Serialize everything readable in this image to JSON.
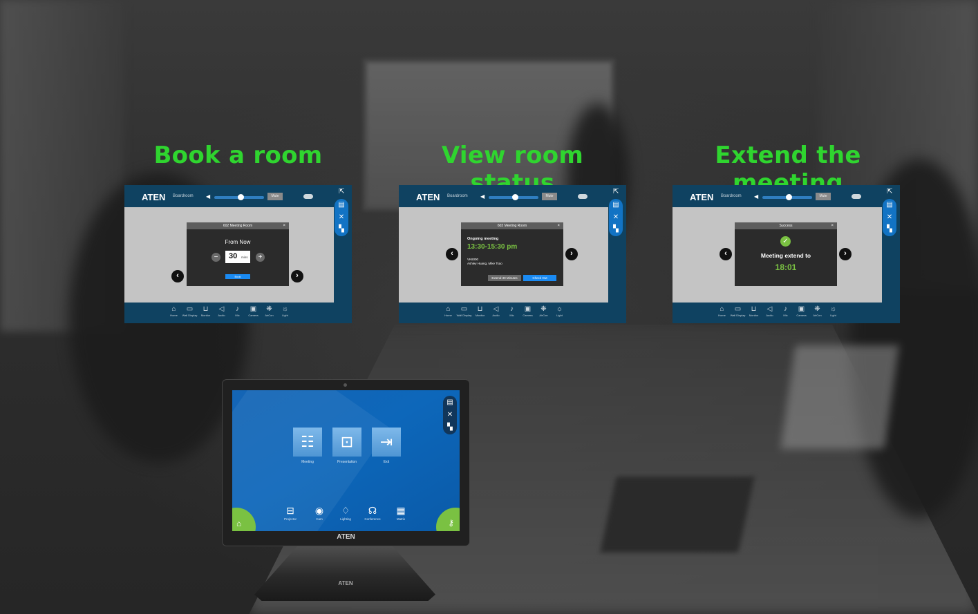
{
  "headings": {
    "book": "Book a room",
    "status": "View room status",
    "extend": "Extend the meeting"
  },
  "colors": {
    "heading": "#2fd52f",
    "panel_navy": "#0f4261",
    "accent_blue": "#1273c4",
    "accent_green": "#7ac142",
    "time_green": "#7ac142"
  },
  "panel_common": {
    "logo": "ATEN",
    "room": "Boardroom",
    "mute": "Mute",
    "nav": [
      {
        "icon": "home-icon",
        "glyph": "⌂",
        "label": "Home"
      },
      {
        "icon": "wall-display-icon",
        "glyph": "▭",
        "label": "Wall Display"
      },
      {
        "icon": "monitor-icon",
        "glyph": "⊔",
        "label": "Monitor"
      },
      {
        "icon": "audio-icon",
        "glyph": "◁",
        "label": "Audio"
      },
      {
        "icon": "mic-icon",
        "glyph": "♪",
        "label": "Mic"
      },
      {
        "icon": "camera-icon",
        "glyph": "▣",
        "label": "Camera"
      },
      {
        "icon": "aircon-icon",
        "glyph": "❋",
        "label": "AirCon"
      },
      {
        "icon": "light-icon",
        "glyph": "☼",
        "label": "Light"
      }
    ]
  },
  "book_dialog": {
    "title": "602 Meeting Room",
    "close": "×",
    "from": "From Now",
    "value": "30",
    "unit": "mins",
    "minus": "−",
    "plus": "+",
    "button": "Book"
  },
  "status_dialog": {
    "title": "602 Meeting Room",
    "close": "×",
    "label": "Ongoing meeting",
    "time": "13:30-15:30 pm",
    "code": "VK6000",
    "people": "Ashley Huang, Mike Tsao",
    "extend_button": "Extend 30 Minutes",
    "checkout_button": "Check Out"
  },
  "extend_dialog": {
    "title": "Success",
    "close": "×",
    "message": "Meeting extend to",
    "time": "18:01"
  },
  "device": {
    "brand": "ATEN",
    "stand_brand": "ATEN",
    "apps": [
      {
        "icon": "meeting-icon",
        "glyph": "☷",
        "label": "Meeting"
      },
      {
        "icon": "presentation-icon",
        "glyph": "⊡",
        "label": "Presentation"
      },
      {
        "icon": "exit-icon",
        "glyph": "⇥",
        "label": "Exit"
      }
    ],
    "dock": [
      {
        "icon": "projector-icon",
        "glyph": "⊟",
        "label": "Projector"
      },
      {
        "icon": "cam-icon",
        "glyph": "◉",
        "label": "Cam"
      },
      {
        "icon": "lighting-icon",
        "glyph": "♢",
        "label": "Lighting"
      },
      {
        "icon": "conference-icon",
        "glyph": "☊",
        "label": "Conference"
      },
      {
        "icon": "matrix-icon",
        "glyph": "▦",
        "label": "Matrix"
      }
    ]
  }
}
